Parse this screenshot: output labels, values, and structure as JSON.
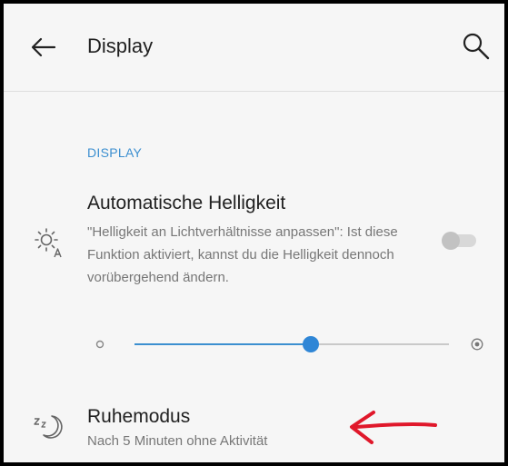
{
  "header": {
    "title": "Display",
    "back_icon": "arrow-left-icon",
    "search_icon": "search-icon"
  },
  "section": {
    "label": "DISPLAY"
  },
  "auto_brightness": {
    "title": "Automatische Helligkeit",
    "summary": "\"Helligkeit an Lichtverhältnisse anpassen\": Ist diese Funktion aktiviert, kannst du die Helligkeit dennoch vorübergehend ändern.",
    "icon": "auto-brightness-icon",
    "enabled": false
  },
  "brightness_slider": {
    "level": 0.56,
    "min_icon": "brightness-low-icon",
    "max_icon": "brightness-high-icon"
  },
  "sleep": {
    "title": "Ruhemodus",
    "summary": "Nach 5 Minuten ohne Aktivität",
    "icon": "sleep-mode-icon"
  },
  "annotation": {
    "icon": "red-arrow-annotation",
    "color": "#e0182b"
  },
  "colors": {
    "accent": "#3c8fd0",
    "background": "#f6f6f6",
    "primary_text": "#212121",
    "secondary_text": "#777777"
  }
}
